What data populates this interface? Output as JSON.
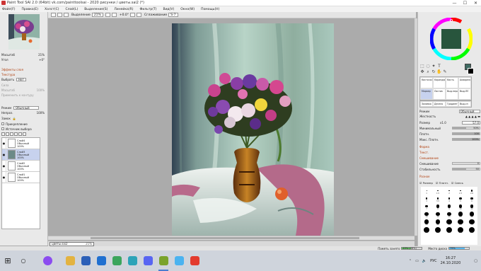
{
  "window": {
    "title": "Paint Tool SAI 2.0 (64bit) vk.com/painttoolsai - 2020 рисунки / цветы.sai2 (*)",
    "controls": [
      "—",
      "☐",
      "✕"
    ]
  },
  "menu": [
    "Файл(F)",
    "Правка(E)",
    "Холст(C)",
    "Слой(L)",
    "Выделение(S)",
    "Линейка(R)",
    "Фильтр(T)",
    "Вид(V)",
    "Окно(W)",
    "Помощь(H)"
  ],
  "toolbar": {
    "selection_label": "Выделение",
    "zoom": "21%",
    "angle": "+0.0°",
    "smoothing_label": "Сглаживание",
    "smoothing_value": "S-7"
  },
  "navigator": {
    "zoom_label": "Масштаб",
    "zoom_value": "21%",
    "angle_label": "Угол",
    "angle_value": "+0°"
  },
  "layer_panel": {
    "effects_label": "Эффекты слоя",
    "texture_label": "Текстура",
    "choose_label": "Выбрать",
    "choose_value": "Нет",
    "strength_label": "Сила",
    "scale_label": "Масштаб",
    "scale_value": "100%",
    "apply_label": "Применить к контуру",
    "mode_label": "Режим",
    "mode_value": "Обычный",
    "opacity_label": "Непроз.",
    "opacity_value": "100%",
    "lock_label": "Замок",
    "clip_label": "Прикрепление",
    "source_label": "Источник выбора",
    "layers": [
      {
        "name": "Слой4",
        "mode": "Обычный",
        "opacity": "100%",
        "selected": false
      },
      {
        "name": "Слой3",
        "mode": "Обычный",
        "opacity": "100%",
        "selected": true
      },
      {
        "name": "Слой2",
        "mode": "Обычный",
        "opacity": "100%",
        "selected": false
      },
      {
        "name": "Слой1",
        "mode": "Обычный",
        "opacity": "100%",
        "selected": false
      }
    ]
  },
  "file_tab": {
    "name": "цветы.sai2",
    "zoom": "21%"
  },
  "tools": {
    "brushes": [
      {
        "label": "Кисточка",
        "active": false
      },
      {
        "label": "Карандаш",
        "active": false
      },
      {
        "label": "Кисть",
        "active": false
      },
      {
        "label": "Акварель",
        "active": false
      },
      {
        "label": "Маркер",
        "active": true
      },
      {
        "label": "Ластик",
        "active": false
      },
      {
        "label": "Выд.пера",
        "active": false
      },
      {
        "label": "Выд.ЛЕ",
        "active": false
      }
    ],
    "brush_row2": [
      "Заливка",
      "Десело",
      "Градиент",
      "Выд.сп"
    ]
  },
  "brush_props": {
    "mode_label": "Режим",
    "mode_value": "Обычный",
    "hardness_label": "Жесткость",
    "size_label": "Размер",
    "size_mult": "x1.0",
    "size_value": "57.0",
    "min_label": "Минимальный",
    "min_value": "50%",
    "density_label": "Плотн.",
    "density_value": "100",
    "max_density_label": "Макс. Плотн.",
    "max_density_value": "100%",
    "form_label": "Форма",
    "texture_label": "Текст.",
    "mixing_label": "Смешивание",
    "blend_label": "Смешивание",
    "blend_value": "0",
    "stability_label": "Стабильность",
    "stability_value": "50",
    "extra_label": "Разное",
    "checks": [
      "Размер",
      "Плотн.",
      "Смесь"
    ],
    "presets": [
      "1",
      "1.5",
      "2",
      "2.3",
      "2.6",
      "3",
      "3.5",
      "4",
      "5",
      "6",
      "7",
      "8",
      "9",
      "10",
      "12",
      "14",
      "16",
      "20",
      "25",
      "30",
      "35",
      "40",
      "50",
      "60",
      "70",
      "80",
      "100",
      "120",
      "160",
      "200"
    ]
  },
  "status": {
    "memory_label": "Память занято",
    "memory_value": "45% (46%)",
    "disk_label": "Место диска",
    "disk_value": "79%"
  },
  "taskbar": {
    "tray_lang": "РУС",
    "time": "16:27",
    "date": "24.10.2020",
    "app_icons": [
      {
        "name": "file-explorer-icon",
        "color": "#e3b341"
      },
      {
        "name": "store-icon",
        "color": "#2b5fb8"
      },
      {
        "name": "mail-icon",
        "color": "#1f6fd0"
      },
      {
        "name": "chrome-icon",
        "color": "#3ba55d"
      },
      {
        "name": "vpn-icon",
        "color": "#2ca3b8"
      },
      {
        "name": "discord-icon",
        "color": "#5865f2"
      },
      {
        "name": "paint-tool-sai-icon",
        "color": "#7aa32c"
      },
      {
        "name": "w-app-icon",
        "color": "#4bb3f0"
      },
      {
        "name": "yandex-browser-icon",
        "color": "#e33b2e"
      }
    ]
  },
  "colors": {
    "accent": "#4a7dd1",
    "canvas_bg": "#ababab",
    "current_color": "#000000"
  }
}
